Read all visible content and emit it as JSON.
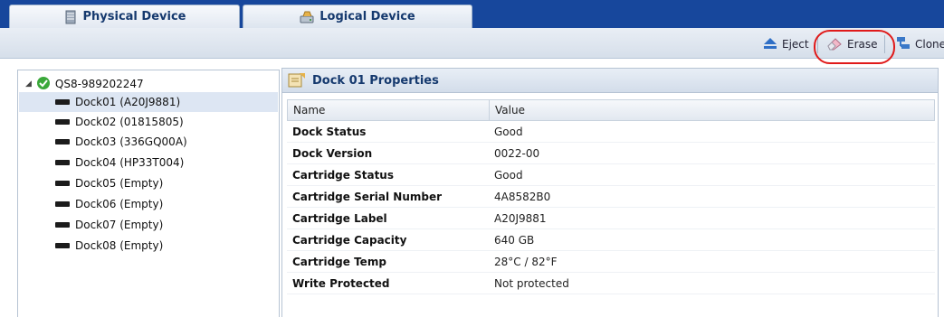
{
  "tabs": [
    {
      "label": "Physical Device",
      "icon": "server-icon",
      "active": true
    },
    {
      "label": "Logical Device",
      "icon": "drive-icon",
      "active": false
    }
  ],
  "toolbar": {
    "eject_label": "Eject",
    "erase_label": "Erase",
    "clone_label": "Clone"
  },
  "tree": {
    "root_label": "QS8-989202247",
    "root_status": "ok",
    "items": [
      {
        "label": "Dock01 (A20J9881)",
        "selected": true
      },
      {
        "label": "Dock02 (01815805)",
        "selected": false
      },
      {
        "label": "Dock03 (336GQ00A)",
        "selected": false
      },
      {
        "label": "Dock04 (HP33T004)",
        "selected": false
      },
      {
        "label": "Dock05 (Empty)",
        "selected": false
      },
      {
        "label": "Dock06 (Empty)",
        "selected": false
      },
      {
        "label": "Dock07 (Empty)",
        "selected": false
      },
      {
        "label": "Dock08 (Empty)",
        "selected": false
      }
    ]
  },
  "properties": {
    "title": "Dock 01 Properties",
    "col_name": "Name",
    "col_value": "Value",
    "rows": [
      {
        "name": "Dock Status",
        "value": "Good"
      },
      {
        "name": "Dock Version",
        "value": "0022-00"
      },
      {
        "name": "Cartridge Status",
        "value": "Good"
      },
      {
        "name": "Cartridge Serial Number",
        "value": "4A8582B0"
      },
      {
        "name": "Cartridge Label",
        "value": "A20J9881"
      },
      {
        "name": "Cartridge Capacity",
        "value": "640 GB"
      },
      {
        "name": "Cartridge Temp",
        "value": "28°C / 82°F"
      },
      {
        "name": "Write Protected",
        "value": "Not protected"
      }
    ]
  },
  "colors": {
    "tab_bar": "#17479c",
    "accent_text": "#15396e",
    "highlight": "#e01a1a",
    "status_ok": "#3aa83a"
  }
}
